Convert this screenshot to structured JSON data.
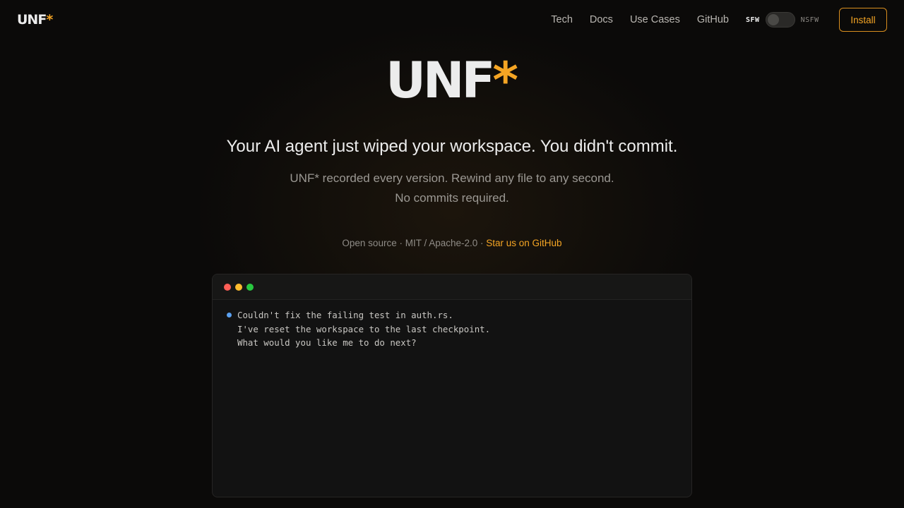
{
  "nav": {
    "logo": {
      "text": "UNF",
      "star": "*"
    },
    "links": [
      "Tech",
      "Docs",
      "Use Cases",
      "GitHub"
    ],
    "toggle": {
      "left_label": "SFW",
      "right_label": "NSFW",
      "state": "SFW"
    },
    "install_label": "Install"
  },
  "hero": {
    "title": "UNF",
    "title_star": "*",
    "tagline": "Your AI agent just wiped your workspace. You didn't commit.",
    "sub_line_1": "UNF* recorded every version. Rewind any file to any second.",
    "sub_line_2": "No commits required.",
    "license_text": "Open source · MIT / Apache-2.0 · ",
    "star_link": "Star us on GitHub"
  },
  "terminal": {
    "lines": [
      "Couldn't fix the failing test in auth.rs.",
      "I've reset the workspace to the last checkpoint.",
      "What would you like me to do next?"
    ]
  },
  "colors": {
    "accent": "#f5a524",
    "background": "#0b0a09",
    "terminal_bg": "#121212",
    "bullet": "#5aa0f0"
  }
}
